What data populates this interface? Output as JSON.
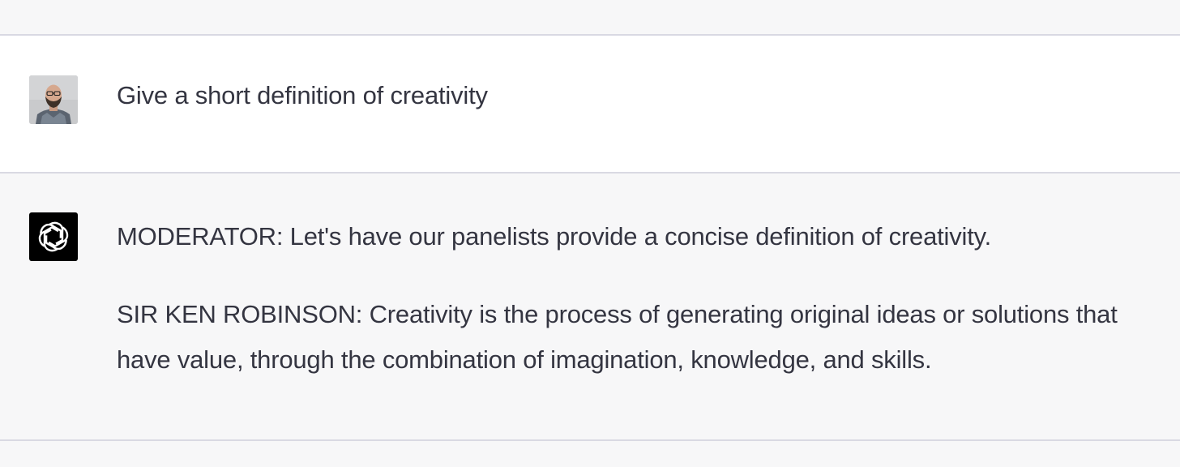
{
  "conversation": {
    "messages": [
      {
        "role": "user",
        "avatar_icon": "user-photo-avatar",
        "text": "Give a short definition of creativity"
      },
      {
        "role": "assistant",
        "avatar_icon": "openai-logo-icon",
        "paragraphs": [
          "MODERATOR: Let's have our panelists provide a concise definition of creativity.",
          "SIR KEN ROBINSON: Creativity is the process of generating original ideas or solutions that have value, through the combination of imagination, knowledge, and skills."
        ]
      }
    ]
  },
  "colors": {
    "user_row_bg": "#ffffff",
    "assistant_row_bg": "#f7f7f8",
    "divider": "#d9d9e3",
    "text": "#343541",
    "bot_avatar_bg": "#000000"
  }
}
